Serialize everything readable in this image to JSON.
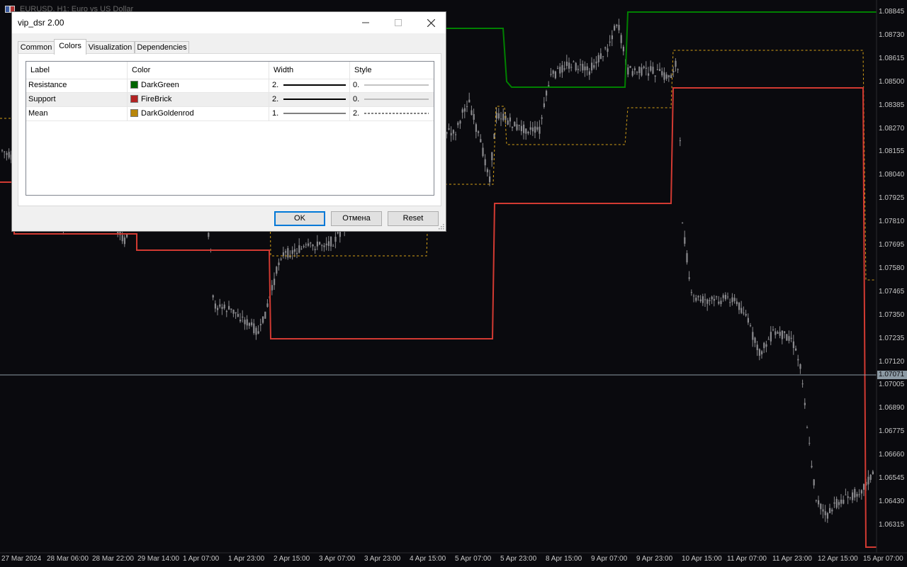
{
  "chart": {
    "title": "EURUSD, H1:  Euro vs US Dollar",
    "current_price": "1.07071",
    "colors": {
      "background": "#0a0a0e",
      "candles": "#8a8a8e",
      "resistance": "#008000",
      "support": "#d23a32",
      "mean": "#d4a017",
      "crosshair": "#8c9aa4"
    },
    "price_labels": [
      "1.08845",
      "1.08730",
      "1.08615",
      "1.08500",
      "1.08385",
      "1.08270",
      "1.08155",
      "1.08040",
      "1.07925",
      "1.07810",
      "1.07695",
      "1.07580",
      "1.07465",
      "1.07350",
      "1.07235",
      "1.07120",
      "1.07005",
      "1.06890",
      "1.06775",
      "1.06660",
      "1.06545",
      "1.06430",
      "1.06315"
    ],
    "time_labels": [
      "27 Mar 2024",
      "28 Mar 06:00",
      "28 Mar 22:00",
      "29 Mar 14:00",
      "1 Apr 07:00",
      "1 Apr 23:00",
      "2 Apr 15:00",
      "3 Apr 07:00",
      "3 Apr 23:00",
      "4 Apr 15:00",
      "5 Apr 07:00",
      "5 Apr 23:00",
      "8 Apr 15:00",
      "9 Apr 07:00",
      "9 Apr 23:00",
      "10 Apr 15:00",
      "11 Apr 07:00",
      "11 Apr 23:00",
      "12 Apr 15:00",
      "15 Apr 07:00"
    ]
  },
  "dialog": {
    "title": "vip_dsr 2.00",
    "tabs": [
      "Common",
      "Colors",
      "Visualization",
      "Dependencies"
    ],
    "active_tab": "Colors",
    "columns": [
      "Label",
      "Color",
      "Width",
      "Style"
    ],
    "rows": [
      {
        "label": "Resistance",
        "color_name": "DarkGreen",
        "color_hex": "#006400",
        "width": "2.",
        "style": "0.",
        "style_kind": "solid-thin"
      },
      {
        "label": "Support",
        "color_name": "FireBrick",
        "color_hex": "#b22222",
        "width": "2.",
        "style": "0.",
        "style_kind": "solid-thin"
      },
      {
        "label": "Mean",
        "color_name": "DarkGoldenrod",
        "color_hex": "#b8860b",
        "width": "1.",
        "style": "2.",
        "style_kind": "dashed"
      }
    ],
    "buttons": {
      "ok": "OK",
      "cancel": "Отмена",
      "reset": "Reset"
    }
  }
}
